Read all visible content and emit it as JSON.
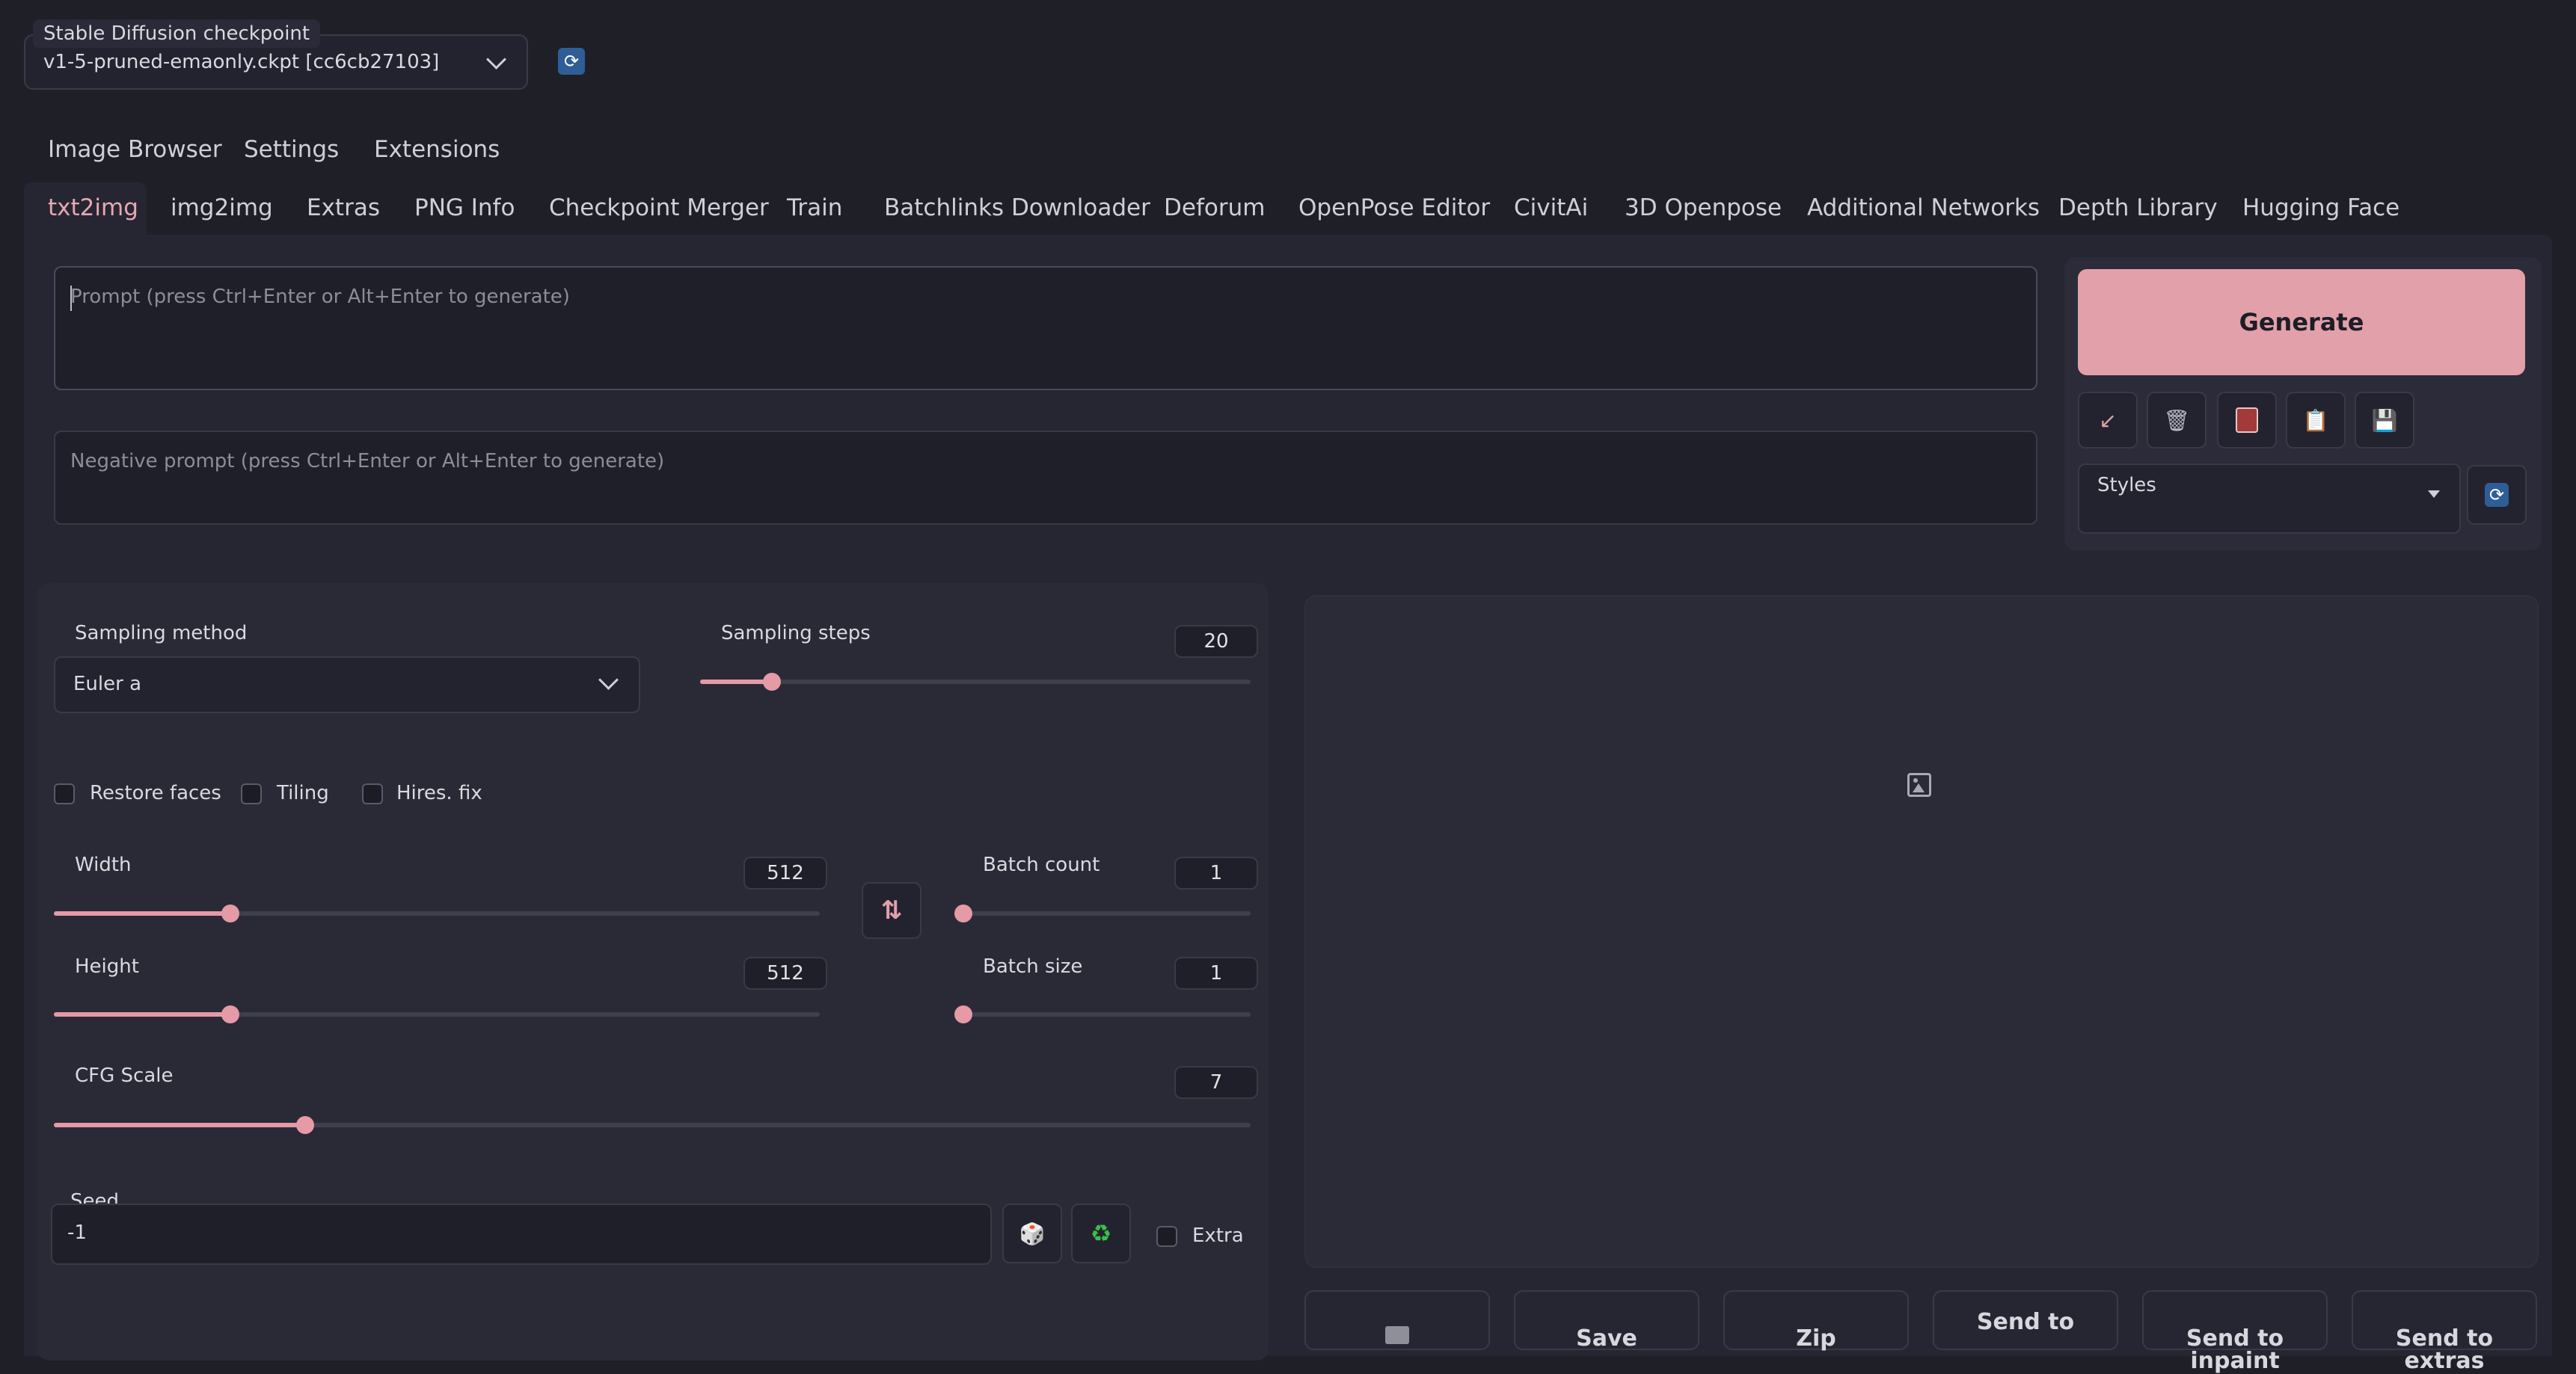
{
  "checkpoint": {
    "label": "Stable Diffusion checkpoint",
    "value": "v1-5-pruned-emaonly.ckpt [cc6cb27103]",
    "refresh_icon": "refresh-icon"
  },
  "top_tabs": [
    "Image Browser",
    "Settings",
    "Extensions"
  ],
  "main_tabs": [
    "txt2img",
    "img2img",
    "Extras",
    "PNG Info",
    "Checkpoint Merger",
    "Train",
    "Batchlinks Downloader",
    "Deforum",
    "OpenPose Editor",
    "CivitAi",
    "3D Openpose",
    "Additional Networks",
    "Depth Library",
    "Hugging Face"
  ],
  "prompt": {
    "placeholder": "Prompt (press Ctrl+Enter or Alt+Enter to generate)"
  },
  "negative_prompt": {
    "placeholder": "Negative prompt (press Ctrl+Enter or Alt+Enter to generate)"
  },
  "generate": {
    "label": "Generate",
    "color": "#e2a0aa"
  },
  "tool_icons": [
    "arrow-down-left-icon",
    "trash-icon",
    "card-icon",
    "clipboard-icon",
    "save-icon"
  ],
  "styles": {
    "label": "Styles",
    "value": ""
  },
  "sampling_method": {
    "label": "Sampling method",
    "value": "Euler a"
  },
  "sampling_steps": {
    "label": "Sampling steps",
    "value": "20",
    "fraction": 0.13
  },
  "checkboxes": {
    "restore_faces": "Restore faces",
    "tiling": "Tiling",
    "hires_fix": "Hires. fix",
    "extra": "Extra"
  },
  "width": {
    "label": "Width",
    "value": "512",
    "fraction": 0.23
  },
  "height": {
    "label": "Height",
    "value": "512",
    "fraction": 0.23
  },
  "batch_count": {
    "label": "Batch count",
    "value": "1",
    "fraction": 0.0
  },
  "batch_size": {
    "label": "Batch size",
    "value": "1",
    "fraction": 0.0
  },
  "cfg_scale": {
    "label": "CFG Scale",
    "value": "7",
    "fraction": 0.21
  },
  "seed": {
    "label": "Seed",
    "value": "-1"
  },
  "bottom_buttons": [
    "Save",
    "Zip",
    "Send to",
    "Send to inpaint",
    "Send to extras"
  ],
  "accent_color": "#e59aa6"
}
